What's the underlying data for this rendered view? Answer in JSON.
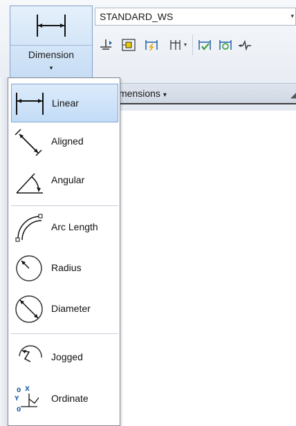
{
  "ribbon": {
    "big_button": {
      "label": "Dimension",
      "icon": "linear-dimension-icon",
      "dropdown": "▾"
    },
    "style_select": {
      "value": "STANDARD_WS",
      "dropdown": "▾"
    },
    "panel_title": "mensions",
    "panel_title_arrow": "▾",
    "tools": [
      {
        "name": "quick-dimension-icon"
      },
      {
        "name": "continue-dimension-icon"
      },
      {
        "name": "dimension-break-icon"
      },
      {
        "name": "dimension-space-icon"
      },
      {
        "name": "inspect-dimension-icon"
      },
      {
        "name": "update-dimension-icon"
      },
      {
        "name": "jog-line-icon"
      }
    ]
  },
  "menu": {
    "items": [
      {
        "label": "Linear",
        "icon": "linear-icon",
        "selected": true
      },
      {
        "label": "Aligned",
        "icon": "aligned-icon"
      },
      {
        "label": "Angular",
        "icon": "angular-icon"
      },
      {
        "label": "Arc Length",
        "icon": "arc-length-icon"
      },
      {
        "label": "Radius",
        "icon": "radius-icon"
      },
      {
        "label": "Diameter",
        "icon": "diameter-icon"
      },
      {
        "label": "Jogged",
        "icon": "jogged-icon"
      },
      {
        "label": "Ordinate",
        "icon": "ordinate-icon"
      }
    ]
  },
  "colors": {
    "accent": "#c3dcf7",
    "accent_border": "#7da2ce",
    "icon_blue": "#1f5fa8",
    "icon_green": "#2c9a2c"
  }
}
